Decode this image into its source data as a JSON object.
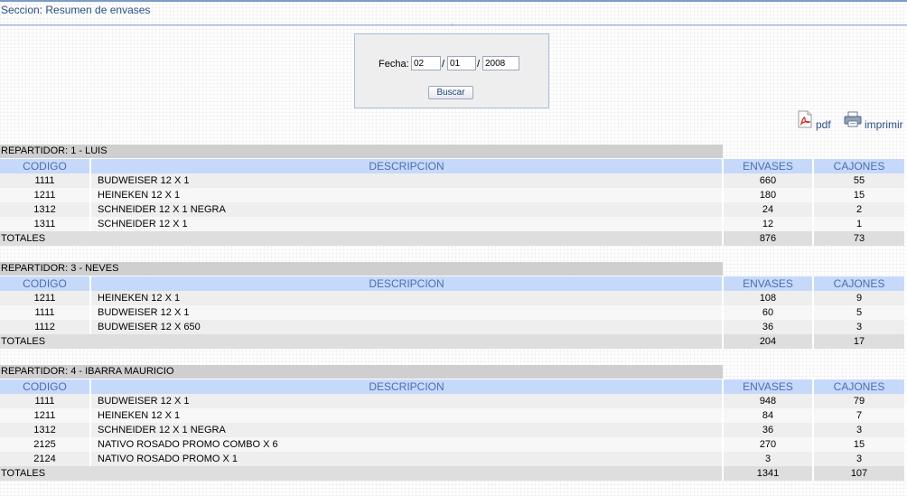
{
  "section": {
    "title": "Seccion: Resumen de envases"
  },
  "filter": {
    "label": "Fecha:",
    "day": "02",
    "month": "01",
    "year": "2008",
    "sep1": "/",
    "sep2": "/",
    "button": "Buscar"
  },
  "export": {
    "pdf_label": "pdf",
    "print_label": "imprimir"
  },
  "colors": {
    "header_bg": "#c7d9fb",
    "header_text": "#4a6fae",
    "title_bar": "#cfcfcf",
    "link": "#2a4f86"
  },
  "columns": [
    "CODIGO",
    "DESCRIPCION",
    "ENVASES",
    "CAJONES"
  ],
  "totals_label": "TOTALES",
  "groups": [
    {
      "title": "REPARTIDOR: 1 - LUIS",
      "rows": [
        {
          "codigo": "1111",
          "descripcion": "BUDWEISER 12 X 1",
          "envases": "660",
          "cajones": "55"
        },
        {
          "codigo": "1211",
          "descripcion": "HEINEKEN 12 X 1",
          "envases": "180",
          "cajones": "15"
        },
        {
          "codigo": "1312",
          "descripcion": "SCHNEIDER 12 X 1 NEGRA",
          "envases": "24",
          "cajones": "2"
        },
        {
          "codigo": "1311",
          "descripcion": "SCHNEIDER 12 X 1",
          "envases": "12",
          "cajones": "1"
        }
      ],
      "total_envases": "876",
      "total_cajones": "73"
    },
    {
      "title": "REPARTIDOR: 3 - NEVES",
      "rows": [
        {
          "codigo": "1211",
          "descripcion": "HEINEKEN 12 X 1",
          "envases": "108",
          "cajones": "9"
        },
        {
          "codigo": "1111",
          "descripcion": "BUDWEISER 12 X 1",
          "envases": "60",
          "cajones": "5"
        },
        {
          "codigo": "1112",
          "descripcion": "BUDWEISER 12 X 650",
          "envases": "36",
          "cajones": "3"
        }
      ],
      "total_envases": "204",
      "total_cajones": "17"
    },
    {
      "title": "REPARTIDOR: 4 - IBARRA MAURICIO",
      "rows": [
        {
          "codigo": "1111",
          "descripcion": "BUDWEISER 12 X 1",
          "envases": "948",
          "cajones": "79"
        },
        {
          "codigo": "1211",
          "descripcion": "HEINEKEN 12 X 1",
          "envases": "84",
          "cajones": "7"
        },
        {
          "codigo": "1312",
          "descripcion": "SCHNEIDER 12 X 1 NEGRA",
          "envases": "36",
          "cajones": "3"
        },
        {
          "codigo": "2125",
          "descripcion": "NATIVO ROSADO PROMO COMBO X 6",
          "envases": "270",
          "cajones": "15"
        },
        {
          "codigo": "2124",
          "descripcion": "NATIVO ROSADO PROMO X 1",
          "envases": "3",
          "cajones": "3"
        }
      ],
      "total_envases": "1341",
      "total_cajones": "107"
    }
  ]
}
